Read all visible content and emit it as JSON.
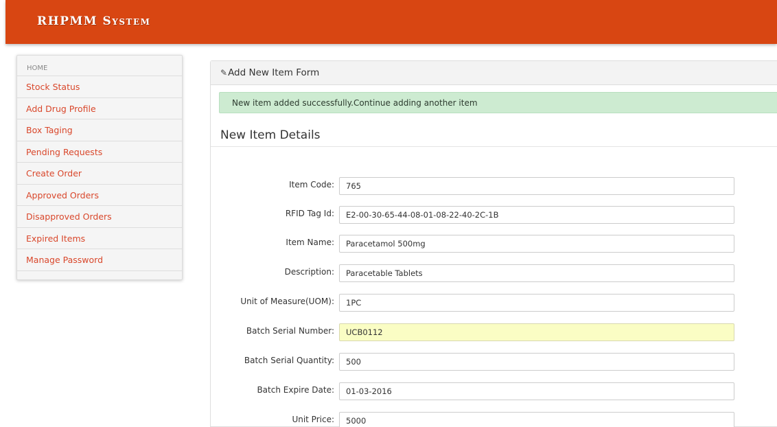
{
  "header": {
    "brand": "RHPMM System"
  },
  "sidebar": {
    "home": "HOME",
    "items": [
      {
        "label": "Stock Status"
      },
      {
        "label": "Add Drug Profile"
      },
      {
        "label": "Box Taging"
      },
      {
        "label": "Pending Requests"
      },
      {
        "label": "Create Order"
      },
      {
        "label": "Approved Orders"
      },
      {
        "label": "Disapproved Orders"
      },
      {
        "label": "Expired Items"
      },
      {
        "label": "Manage Password"
      }
    ]
  },
  "panel": {
    "title": "Add New Item Form",
    "title_icon": "edit-icon",
    "alert": "New item added successfully.Continue adding another item",
    "section_title": "New Item Details"
  },
  "form": {
    "fields": [
      {
        "label": "Item Code:",
        "value": "765"
      },
      {
        "label": "RFID Tag Id:",
        "value": "E2-00-30-65-44-08-01-08-22-40-2C-1B"
      },
      {
        "label": "Item Name:",
        "value": "Paracetamol 500mg"
      },
      {
        "label": "Description:",
        "value": "Paracetable Tablets"
      },
      {
        "label": "Unit of Measure(UOM):",
        "value": "1PC"
      },
      {
        "label": "Batch Serial Number:",
        "value": "UCB0112"
      },
      {
        "label": "Batch Serial Quantity:",
        "value": "500"
      },
      {
        "label": "Batch Expire Date:",
        "value": "01-03-2016"
      },
      {
        "label": "Unit Price:",
        "value": "5000"
      }
    ]
  },
  "colors": {
    "header": "#d84612",
    "link": "#d9472b",
    "success_bg": "#cdebd1",
    "highlight_input": "#fafdc4"
  }
}
